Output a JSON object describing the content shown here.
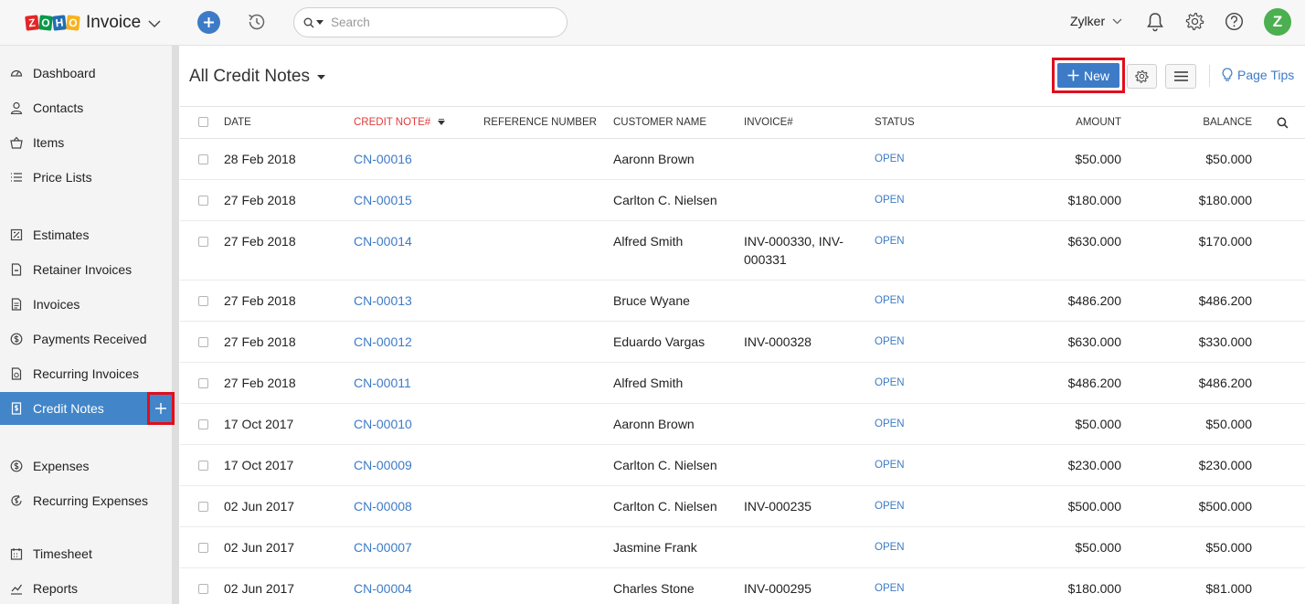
{
  "app": {
    "name": "Invoice",
    "logo_letters": [
      "Z",
      "O",
      "H",
      "O"
    ]
  },
  "topbar": {
    "search_placeholder": "Search",
    "org_name": "Zylker",
    "avatar_initial": "Z"
  },
  "sidebar": {
    "items": [
      {
        "label": "Dashboard",
        "icon": "dashboard-icon"
      },
      {
        "label": "Contacts",
        "icon": "contacts-icon"
      },
      {
        "label": "Items",
        "icon": "items-icon"
      },
      {
        "label": "Price Lists",
        "icon": "price-lists-icon"
      },
      {
        "label": "Estimates",
        "icon": "estimates-icon"
      },
      {
        "label": "Retainer Invoices",
        "icon": "retainer-invoices-icon"
      },
      {
        "label": "Invoices",
        "icon": "invoices-icon"
      },
      {
        "label": "Payments Received",
        "icon": "payments-received-icon"
      },
      {
        "label": "Recurring Invoices",
        "icon": "recurring-invoices-icon"
      },
      {
        "label": "Credit Notes",
        "icon": "credit-notes-icon",
        "active": true
      },
      {
        "label": "Expenses",
        "icon": "expenses-icon"
      },
      {
        "label": "Recurring Expenses",
        "icon": "recurring-expenses-icon"
      },
      {
        "label": "Timesheet",
        "icon": "timesheet-icon"
      },
      {
        "label": "Reports",
        "icon": "reports-icon"
      }
    ]
  },
  "main": {
    "title": "All Credit Notes",
    "new_label": "New",
    "page_tips_label": "Page Tips"
  },
  "table": {
    "headers": {
      "date": "DATE",
      "credit_note": "CREDIT NOTE#",
      "reference": "REFERENCE NUMBER",
      "customer": "CUSTOMER NAME",
      "invoice": "INVOICE#",
      "status": "STATUS",
      "amount": "AMOUNT",
      "balance": "BALANCE"
    },
    "rows": [
      {
        "date": "28 Feb 2018",
        "cn": "CN-00016",
        "ref": "",
        "customer": "Aaronn Brown",
        "invoice": "",
        "status": "OPEN",
        "amount": "$50.000",
        "balance": "$50.000"
      },
      {
        "date": "27 Feb 2018",
        "cn": "CN-00015",
        "ref": "",
        "customer": "Carlton C. Nielsen",
        "invoice": "",
        "status": "OPEN",
        "amount": "$180.000",
        "balance": "$180.000"
      },
      {
        "date": "27 Feb 2018",
        "cn": "CN-00014",
        "ref": "",
        "customer": "Alfred Smith",
        "invoice": "INV-000330, INV-000331",
        "status": "OPEN",
        "amount": "$630.000",
        "balance": "$170.000"
      },
      {
        "date": "27 Feb 2018",
        "cn": "CN-00013",
        "ref": "",
        "customer": "Bruce Wyane",
        "invoice": "",
        "status": "OPEN",
        "amount": "$486.200",
        "balance": "$486.200"
      },
      {
        "date": "27 Feb 2018",
        "cn": "CN-00012",
        "ref": "",
        "customer": "Eduardo Vargas",
        "invoice": "INV-000328",
        "status": "OPEN",
        "amount": "$630.000",
        "balance": "$330.000"
      },
      {
        "date": "27 Feb 2018",
        "cn": "CN-00011",
        "ref": "",
        "customer": "Alfred Smith",
        "invoice": "",
        "status": "OPEN",
        "amount": "$486.200",
        "balance": "$486.200"
      },
      {
        "date": "17 Oct 2017",
        "cn": "CN-00010",
        "ref": "",
        "customer": "Aaronn Brown",
        "invoice": "",
        "status": "OPEN",
        "amount": "$50.000",
        "balance": "$50.000"
      },
      {
        "date": "17 Oct 2017",
        "cn": "CN-00009",
        "ref": "",
        "customer": "Carlton C. Nielsen",
        "invoice": "",
        "status": "OPEN",
        "amount": "$230.000",
        "balance": "$230.000"
      },
      {
        "date": "02 Jun 2017",
        "cn": "CN-00008",
        "ref": "",
        "customer": "Carlton C. Nielsen",
        "invoice": "INV-000235",
        "status": "OPEN",
        "amount": "$500.000",
        "balance": "$500.000"
      },
      {
        "date": "02 Jun 2017",
        "cn": "CN-00007",
        "ref": "",
        "customer": "Jasmine Frank",
        "invoice": "",
        "status": "OPEN",
        "amount": "$50.000",
        "balance": "$50.000"
      },
      {
        "date": "02 Jun 2017",
        "cn": "CN-00004",
        "ref": "",
        "customer": "Charles Stone",
        "invoice": "INV-000295",
        "status": "OPEN",
        "amount": "$180.000",
        "balance": "$81.000"
      }
    ]
  },
  "colors": {
    "accent": "#3d7bc6",
    "active_nav": "#4285c8",
    "highlight_border": "#e10e1c",
    "sorted_header": "#e03b3b",
    "avatar": "#4caf50"
  }
}
